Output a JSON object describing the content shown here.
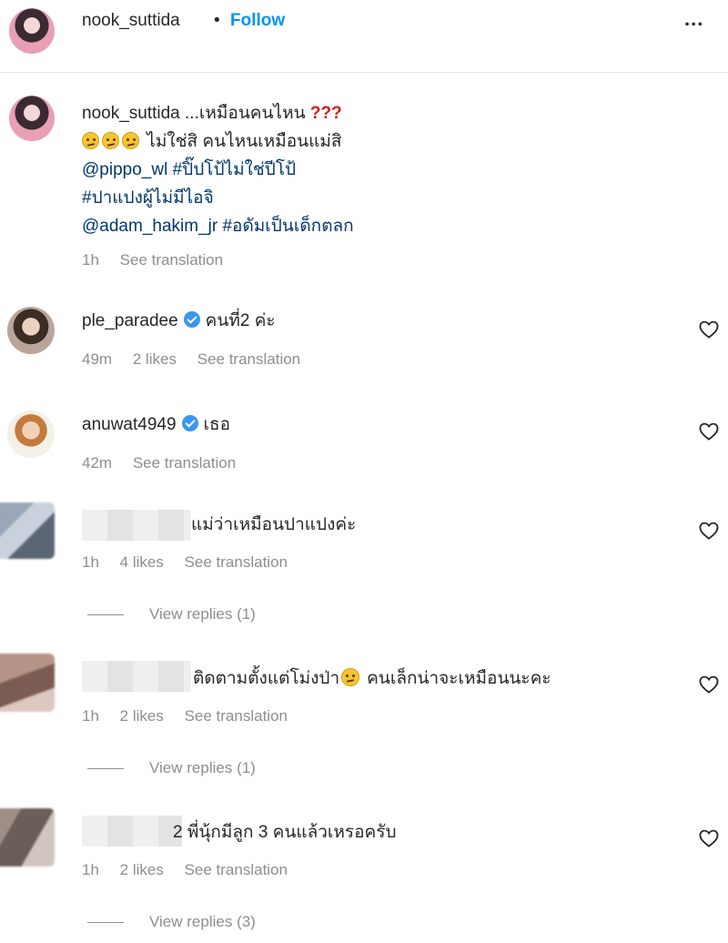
{
  "header": {
    "username": "nook_suttida",
    "separator": "•",
    "follow_label": "Follow",
    "more_label": "..."
  },
  "caption": {
    "username": "nook_suttida",
    "line1_text": "...เหมือนคนไหน",
    "line1_marks": "???",
    "line2_text": "ไม่ใช่สิ คนไหนเหมือนแม่สิ",
    "mention1": "@pippo_wl",
    "hashtag1": "#ปิ๊ปโป้ไม่ใช่ปีโป้",
    "hashtag2": "#ปาแปงผู้ไม่มีไอจิ",
    "mention2": "@adam_hakim_jr",
    "hashtag3": "#อดัมเป็นเด็กตลก",
    "time": "1h",
    "see_translation": "See translation"
  },
  "comments": [
    {
      "username": "ple_paradee",
      "verified": true,
      "text": "คนที่2 ค่ะ",
      "time": "49m",
      "likes": "2 likes",
      "see_translation": "See translation"
    },
    {
      "username": "anuwat4949",
      "verified": true,
      "text": "เธอ",
      "time": "42m",
      "see_translation": "See translation"
    },
    {
      "username": "",
      "text": "แม่ว่าเหมือนปาแปงค่ะ",
      "time": "1h",
      "likes": "4 likes",
      "see_translation": "See translation",
      "view_replies": "View replies (1)"
    },
    {
      "username": "",
      "text": "ติดตามตั้งแต่โม่งป่า",
      "text_after": "คนเล็กน่าจะเหมือนนะคะ",
      "time": "1h",
      "likes": "2 likes",
      "see_translation": "See translation",
      "view_replies": "View replies (1)"
    },
    {
      "username": "",
      "text": "2 พี่นุ้กมีลูก 3 คนแล้วเหรอครับ",
      "time": "1h",
      "likes": "2 likes",
      "see_translation": "See translation",
      "view_replies": "View replies (3)"
    }
  ],
  "colors": {
    "link": "#00376b",
    "follow": "#0095f6",
    "meta": "#8e8e8e",
    "verified": "#3897f0",
    "question_marks": "#d11d1d"
  },
  "icons": {
    "more": "more-options-icon",
    "like": "heart-icon",
    "verified": "verified-badge-icon",
    "emoji": "confused-face-emoji",
    "laugh": "laughing-emoji"
  }
}
